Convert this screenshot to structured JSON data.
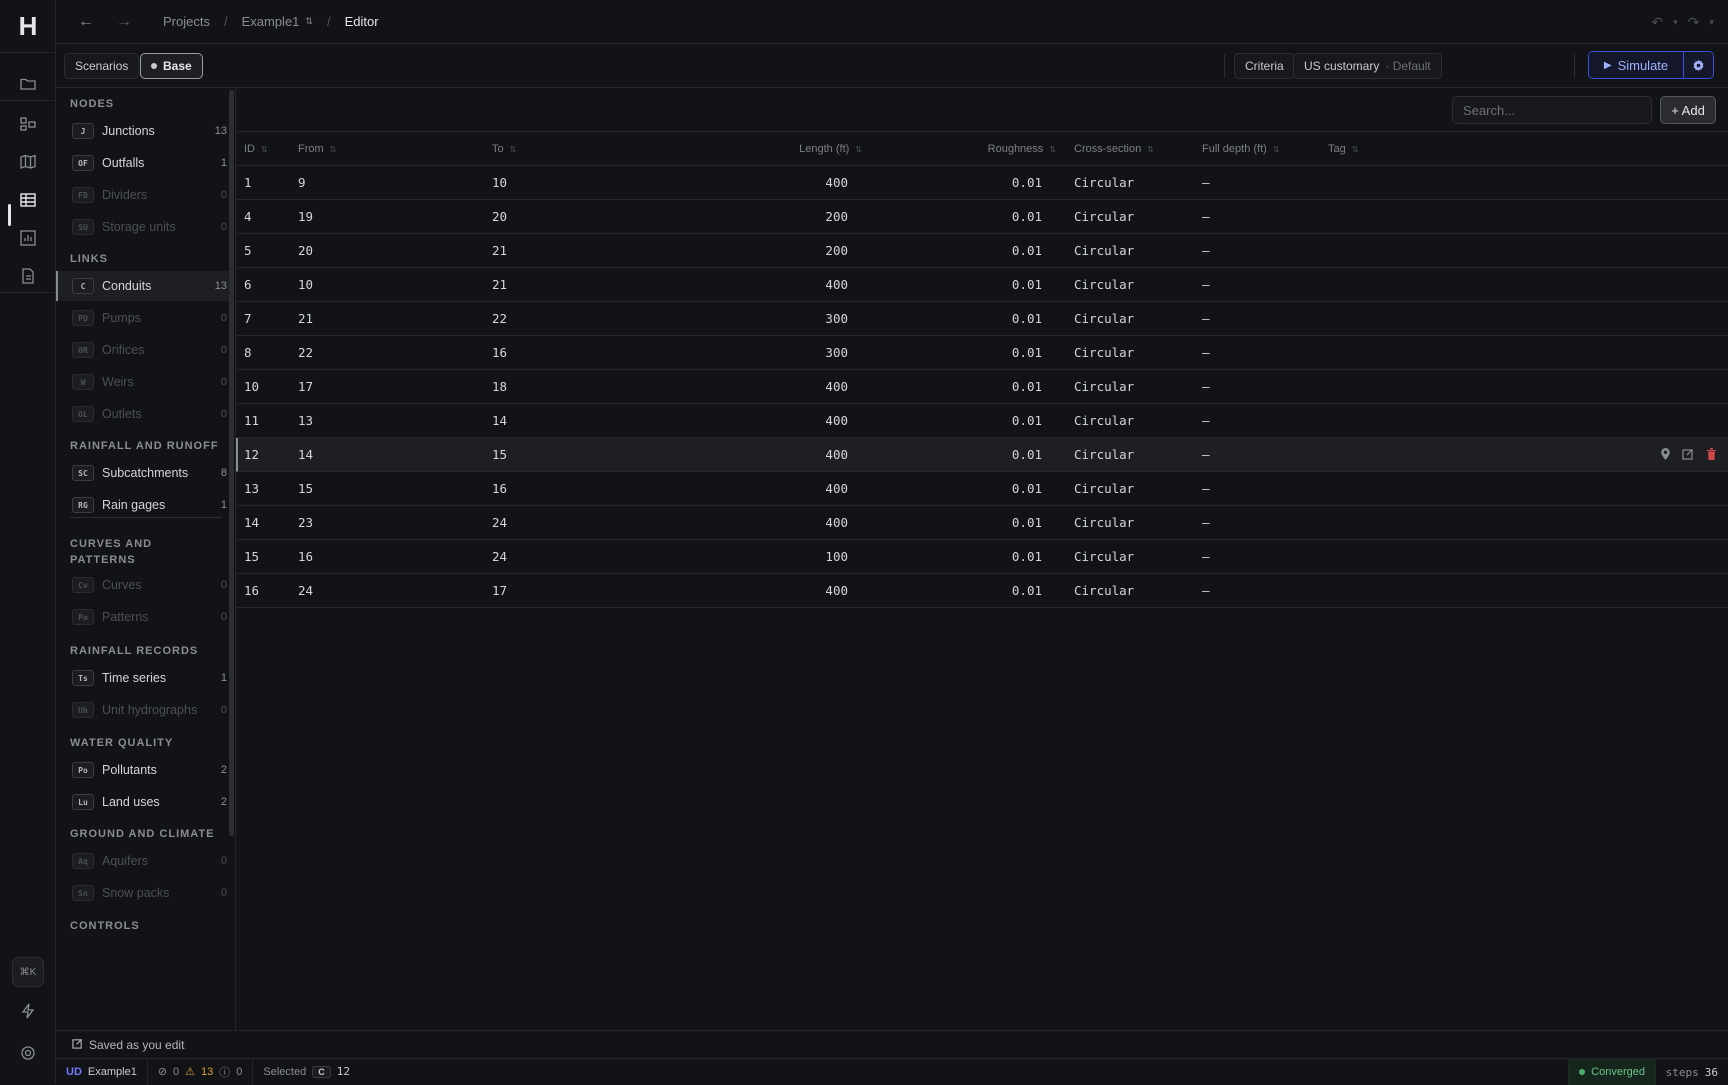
{
  "app": {
    "logo": "H"
  },
  "breadcrumb": {
    "projects": "Projects",
    "project": "Example1",
    "page": "Editor"
  },
  "subbar": {
    "scenarios": "Scenarios",
    "base": "Base",
    "criteria": "Criteria",
    "units": "US customary",
    "units_suffix": "· Default",
    "simulate": "Simulate"
  },
  "sidebar": {
    "sections": [
      {
        "title": "NODES",
        "items": [
          {
            "badge": "J",
            "label": "Junctions",
            "count": "13",
            "dim": false
          },
          {
            "badge": "OF",
            "label": "Outfalls",
            "count": "1",
            "dim": false
          },
          {
            "badge": "FD",
            "label": "Dividers",
            "count": "0",
            "dim": true
          },
          {
            "badge": "SU",
            "label": "Storage units",
            "count": "0",
            "dim": true
          }
        ]
      },
      {
        "title": "LINKS",
        "items": [
          {
            "badge": "C",
            "label": "Conduits",
            "count": "13",
            "dim": false,
            "active": true
          },
          {
            "badge": "PU",
            "label": "Pumps",
            "count": "0",
            "dim": true
          },
          {
            "badge": "OR",
            "label": "Orifices",
            "count": "0",
            "dim": true
          },
          {
            "badge": "W",
            "label": "Weirs",
            "count": "0",
            "dim": true
          },
          {
            "badge": "OL",
            "label": "Outlets",
            "count": "0",
            "dim": true
          }
        ]
      },
      {
        "title": "RAINFALL AND RUNOFF",
        "items": [
          {
            "badge": "SC",
            "label": "Subcatchments",
            "count": "8",
            "dim": false
          },
          {
            "badge": "RG",
            "label": "Rain gages",
            "count": "1",
            "dim": false
          }
        ]
      },
      {
        "title": "CURVES AND PATTERNS",
        "items": [
          {
            "badge": "Cv",
            "label": "Curves",
            "count": "0",
            "dim": true
          },
          {
            "badge": "Pa",
            "label": "Patterns",
            "count": "0",
            "dim": true
          }
        ]
      },
      {
        "title": "RAINFALL RECORDS",
        "items": [
          {
            "badge": "Ts",
            "label": "Time series",
            "count": "1",
            "dim": false
          },
          {
            "badge": "Uh",
            "label": "Unit hydrographs",
            "count": "0",
            "dim": true
          }
        ]
      },
      {
        "title": "WATER QUALITY",
        "items": [
          {
            "badge": "Po",
            "label": "Pollutants",
            "count": "2",
            "dim": false
          },
          {
            "badge": "Lu",
            "label": "Land uses",
            "count": "2",
            "dim": false
          }
        ]
      },
      {
        "title": "GROUND AND CLIMATE",
        "items": [
          {
            "badge": "Aq",
            "label": "Aquifers",
            "count": "0",
            "dim": true
          },
          {
            "badge": "Sn",
            "label": "Snow packs",
            "count": "0",
            "dim": true
          }
        ]
      },
      {
        "title": "CONTROLS",
        "items": []
      }
    ]
  },
  "table": {
    "search_placeholder": "Search...",
    "add_label": "+ Add",
    "columns": [
      "ID",
      "From",
      "To",
      "Length (ft)",
      "Roughness",
      "Cross-section",
      "Full depth (ft)",
      "Tag"
    ],
    "rows": [
      {
        "id": "1",
        "from": "9",
        "to": "10",
        "length": "400",
        "roughness": "0.01",
        "xsection": "Circular",
        "depth": "—",
        "tag": ""
      },
      {
        "id": "4",
        "from": "19",
        "to": "20",
        "length": "200",
        "roughness": "0.01",
        "xsection": "Circular",
        "depth": "—",
        "tag": ""
      },
      {
        "id": "5",
        "from": "20",
        "to": "21",
        "length": "200",
        "roughness": "0.01",
        "xsection": "Circular",
        "depth": "—",
        "tag": ""
      },
      {
        "id": "6",
        "from": "10",
        "to": "21",
        "length": "400",
        "roughness": "0.01",
        "xsection": "Circular",
        "depth": "—",
        "tag": ""
      },
      {
        "id": "7",
        "from": "21",
        "to": "22",
        "length": "300",
        "roughness": "0.01",
        "xsection": "Circular",
        "depth": "—",
        "tag": ""
      },
      {
        "id": "8",
        "from": "22",
        "to": "16",
        "length": "300",
        "roughness": "0.01",
        "xsection": "Circular",
        "depth": "—",
        "tag": ""
      },
      {
        "id": "10",
        "from": "17",
        "to": "18",
        "length": "400",
        "roughness": "0.01",
        "xsection": "Circular",
        "depth": "—",
        "tag": ""
      },
      {
        "id": "11",
        "from": "13",
        "to": "14",
        "length": "400",
        "roughness": "0.01",
        "xsection": "Circular",
        "depth": "—",
        "tag": ""
      },
      {
        "id": "12",
        "from": "14",
        "to": "15",
        "length": "400",
        "roughness": "0.01",
        "xsection": "Circular",
        "depth": "—",
        "tag": "",
        "selected": true
      },
      {
        "id": "13",
        "from": "15",
        "to": "16",
        "length": "400",
        "roughness": "0.01",
        "xsection": "Circular",
        "depth": "—",
        "tag": ""
      },
      {
        "id": "14",
        "from": "23",
        "to": "24",
        "length": "400",
        "roughness": "0.01",
        "xsection": "Circular",
        "depth": "—",
        "tag": ""
      },
      {
        "id": "15",
        "from": "16",
        "to": "24",
        "length": "100",
        "roughness": "0.01",
        "xsection": "Circular",
        "depth": "—",
        "tag": ""
      },
      {
        "id": "16",
        "from": "24",
        "to": "17",
        "length": "400",
        "roughness": "0.01",
        "xsection": "Circular",
        "depth": "—",
        "tag": ""
      }
    ]
  },
  "footer": {
    "saved": "Saved as you edit",
    "ud": "UD",
    "project": "Example1",
    "errors": "0",
    "warnings": "13",
    "info": "0",
    "selected_label": "Selected",
    "selected_badge": "C",
    "selected_value": "12",
    "status": "Converged",
    "steps_label": "steps",
    "steps_value": "36"
  },
  "kbd_hint": "⌘K",
  "colors": {
    "accent": "#3b4fd8",
    "danger": "#d04848",
    "success": "#4caf6e",
    "warning": "#d9a13a"
  }
}
